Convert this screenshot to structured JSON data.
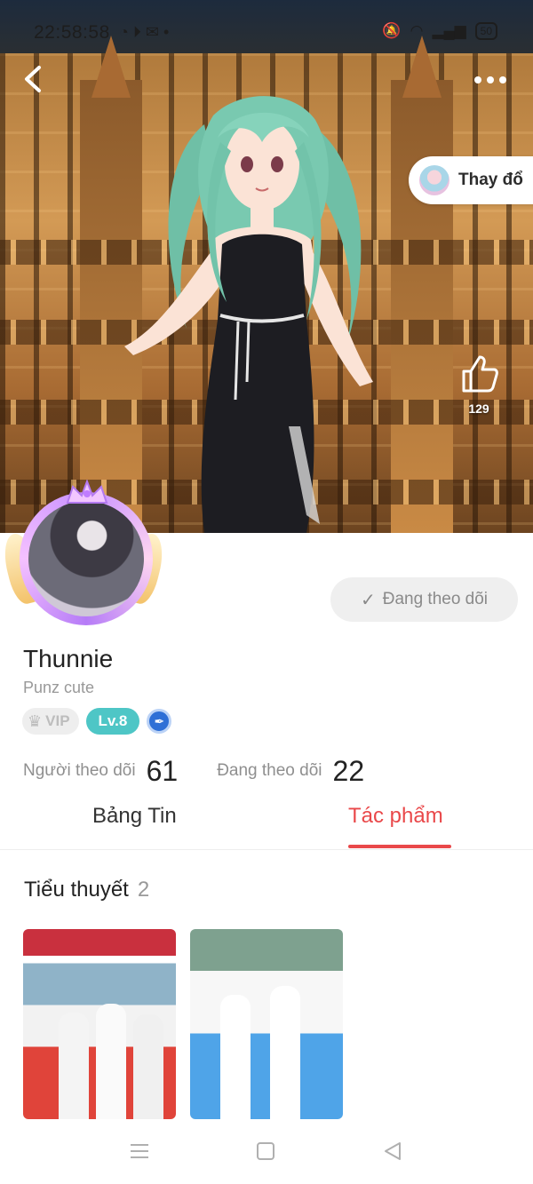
{
  "status_bar": {
    "time": "22:58:58",
    "battery": "50"
  },
  "header": {
    "change_button_label": "Thay đổ",
    "like_count": "129"
  },
  "profile": {
    "follow_button_label": "Đang theo dõi",
    "name": "Thunnie",
    "bio": "Punz cute",
    "vip_label": "VIP",
    "level_label": "Lv.8",
    "followers_label": "Người theo dõi",
    "followers_value": "61",
    "following_label": "Đang theo dõi",
    "following_value": "22"
  },
  "tabs": [
    {
      "label": "Bảng Tin",
      "active": false
    },
    {
      "label": "Tác phẩm",
      "active": true
    }
  ],
  "section": {
    "title": "Tiểu thuyết",
    "count": "2"
  },
  "icons": {
    "back": "chevron-left-icon",
    "more": "more-dots-icon",
    "like": "thumbs-up-icon",
    "follow_check": "check-icon",
    "vip": "crown-icon",
    "level_pen": "pen-icon",
    "nav_menu": "menu-icon",
    "nav_home": "home-square-icon",
    "nav_back": "triangle-back-icon"
  },
  "colors": {
    "accent": "#e9484a",
    "level_badge": "#4ec6c6",
    "follow_button_bg": "#efefef"
  }
}
